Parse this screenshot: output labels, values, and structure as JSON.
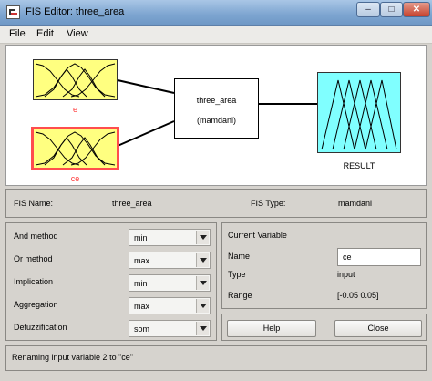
{
  "window": {
    "title": "FIS Editor: three_area",
    "minimize": "–",
    "maximize": "□",
    "close": "✕"
  },
  "menu": {
    "items": [
      "File",
      "Edit",
      "View"
    ]
  },
  "diagram": {
    "inputs": [
      {
        "label": "e",
        "selected": false
      },
      {
        "label": "ce",
        "selected": true
      }
    ],
    "system": {
      "name": "three_area",
      "type": "(mamdani)"
    },
    "output": {
      "label": "RESULT"
    }
  },
  "info": {
    "fis_name_label": "FIS Name:",
    "fis_name_value": "three_area",
    "fis_type_label": "FIS Type:",
    "fis_type_value": "mamdani"
  },
  "methods": [
    {
      "label": "And method",
      "value": "min"
    },
    {
      "label": "Or method",
      "value": "max"
    },
    {
      "label": "Implication",
      "value": "min"
    },
    {
      "label": "Aggregation",
      "value": "max"
    },
    {
      "label": "Defuzzification",
      "value": "som"
    }
  ],
  "current_variable": {
    "title": "Current Variable",
    "name_label": "Name",
    "name_value": "ce",
    "type_label": "Type",
    "type_value": "input",
    "range_label": "Range",
    "range_value": "[-0.05 0.05]"
  },
  "buttons": {
    "help": "Help",
    "close": "Close"
  },
  "status": {
    "text": "Renaming input variable 2 to \"ce\""
  },
  "colors": {
    "input_box": "#ffff80",
    "output_box": "#80ffff",
    "selected_border": "#ff4d4d",
    "panel_bg": "#d6d3ce"
  }
}
